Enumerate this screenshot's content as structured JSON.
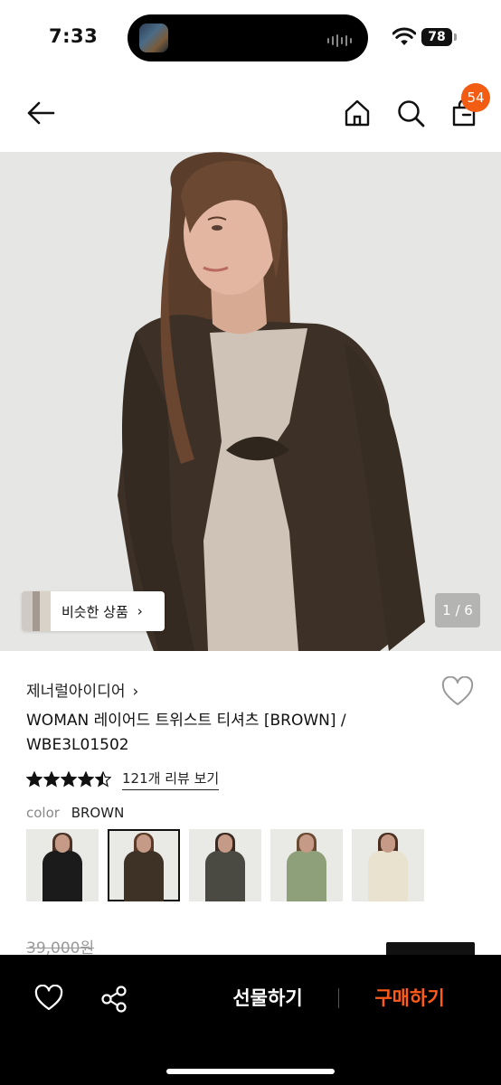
{
  "status": {
    "time": "7:33",
    "battery": "78"
  },
  "nav": {
    "cart_count": "54"
  },
  "hero": {
    "similar_label": "비슷한 상품",
    "similar_chevron": "›",
    "page_indicator": "1 / 6"
  },
  "product": {
    "brand": "제너럴아이디어",
    "brand_chevron": "›",
    "title": "WOMAN 레이어드 트위스트 티셔츠 [BROWN] / WBE3L01502",
    "rating": 4.5,
    "review_link": "121개 리뷰 보기",
    "color_label": "color",
    "color_value": "BROWN",
    "swatches": [
      {
        "color": "#1b1b1b",
        "hair": "#4a3226",
        "selected": false
      },
      {
        "color": "#3e3126",
        "hair": "#5a3a28",
        "selected": true
      },
      {
        "color": "#4b4a42",
        "hair": "#3a2a22",
        "selected": false
      },
      {
        "color": "#8ea07a",
        "hair": "#6b4a32",
        "selected": false
      },
      {
        "color": "#e8e2cf",
        "hair": "#4b3022",
        "selected": false
      }
    ],
    "original_price": "39,000원"
  },
  "bottom_bar": {
    "gift_label": "선물하기",
    "buy_label": "구매하기"
  },
  "colors": {
    "accent": "#f25c13",
    "buy_text": "#ff5b1a"
  }
}
